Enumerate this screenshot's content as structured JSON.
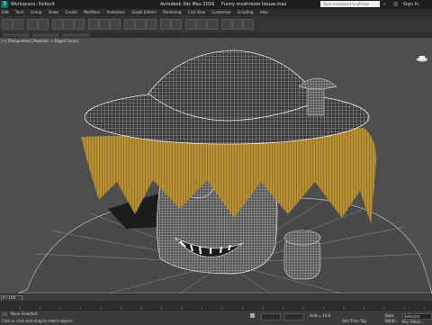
{
  "app": {
    "title": "Autodesk 3ds Max 2016",
    "file": "Funny mushroom house.max",
    "workspace": "Workspace: Default",
    "search_placeholder": "Type a keyword or phrase",
    "sign_in": "Sign In"
  },
  "menu": [
    "Edit",
    "Tools",
    "Group",
    "Views",
    "Create",
    "Modifiers",
    "Animation",
    "Graph Editors",
    "Rendering",
    "Civil View",
    "Customize",
    "Scripting",
    "Help"
  ],
  "viewport": {
    "label": "[+] [Perspective] [Realistic + Edged Faces]"
  },
  "timeline": {
    "frame_label": "0 / 100"
  },
  "status": {
    "prompt_line1": "None Selected",
    "prompt_line2": "Click or click-and-drag to select objects",
    "add_time_tag": "Add Time Tag",
    "grid": "Grid = 10.0",
    "auto": "Auto",
    "set_key": "Set K.",
    "selected": "Selected",
    "key_filters": "Key Filters..."
  },
  "colors": {
    "accent_yellow": "#e8c000",
    "titlebar": "#1e1e1e",
    "viewport_bg": "#4e4e4e"
  }
}
